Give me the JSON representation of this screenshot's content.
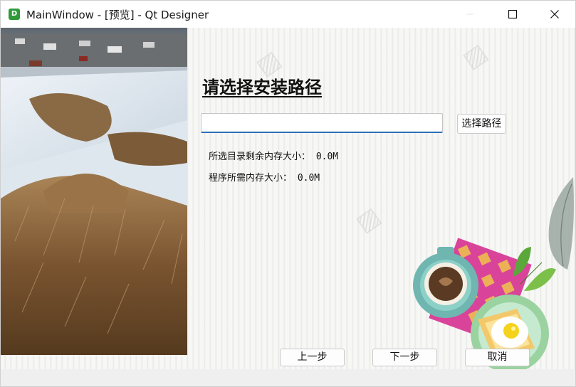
{
  "window": {
    "title": "MainWindow - [预览] - Qt Designer",
    "app_icon_letter": "D"
  },
  "page": {
    "heading": "请选择安装路径",
    "path_input": {
      "value": "",
      "placeholder": ""
    },
    "choose_button": "选择路径",
    "free_space_label": "所选目录剩余内存大小： 0.0M",
    "required_space_label": "程序所需内存大小： 0.0M"
  },
  "footer": {
    "prev_button": "上一步",
    "next_button": "下一步",
    "cancel_button": "取消"
  },
  "colors": {
    "input_focus": "#2a6fb8",
    "app_icon": "#2e9a3a"
  }
}
